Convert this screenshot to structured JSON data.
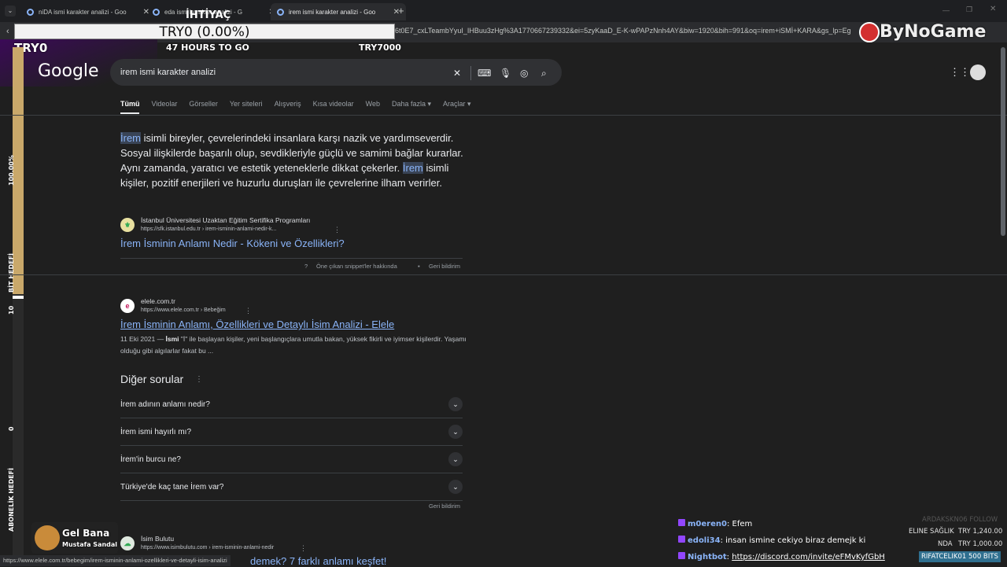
{
  "browser": {
    "tabs": [
      {
        "title": "niDA ismi karakter analizi - Goo"
      },
      {
        "title": "eda ismi karakter analizi - G"
      },
      {
        "title": "irem ismi karakter analizi - Goo"
      }
    ],
    "new_tab": "+",
    "url": "6t0E7_cxLTeambYyuI_IHBuu3zHg%3A1770667239332&ei=5zyKaaD_E-K-wPAPzNnh4AY&biw=1920&bih=991&oq=irem+iSMİ+KARA&gs_lp=Eg",
    "status_url": "https://www.elele.com.tr/bebegim/irem-isminin-anlami-ozellikleri-ve-detayli-isim-analizi"
  },
  "overlay": {
    "donation_label": "İHTİYAÇ",
    "donation_bar": "TRY0 (0.00%)",
    "left_value": "TRY0",
    "hours": "47 HOURS TO GO",
    "goal": "TRY7000",
    "brand": "ByNoGame",
    "bar_labels": {
      "pct": "100.00%",
      "bit": "BİT HEDEFİ",
      "ten": "10",
      "zero": "0",
      "abone": "ABONELİK HEDEFİ"
    },
    "streamer_song": "Gel Bana",
    "streamer_artist": "Mustafa Sandal"
  },
  "google": {
    "logo": "Google",
    "query": "irem ismi karakter analizi",
    "nav": [
      "Tümü",
      "Videolar",
      "Görseller",
      "Yer siteleri",
      "Alışveriş",
      "Kısa videolar",
      "Web",
      "Daha fazla ▾",
      "Araçlar ▾"
    ],
    "snippet": {
      "t1": "İrem",
      "t2": " isimli bireyler, çevrelerindeki insanlara karşı nazik ve yardımseverdir. Sosyal ilişkilerde başarılı olup, sevdikleriyle güçlü ve samimi bağlar kurarlar. Aynı zamanda, yaratıcı ve estetik yeteneklerle dikkat çekerler. ",
      "t3": "İrem",
      "t4": " isimli kişiler, pozitif enerjileri ve huzurlu duruşları ile çevrelerine ilham verirler."
    },
    "featured": {
      "site": "İstanbul Üniversitesi Uzaktan Eğitim Sertifika Programları",
      "url": "https://sfk.istanbul.edu.tr › irem-isminin-anlami-nedir-k...",
      "title": "İrem İsminin Anlamı Nedir - Kökeni ve Özellikleri?",
      "about": "Öne çıkan snippet'ler hakkında",
      "feedback": "Geri bildirim"
    },
    "result1": {
      "site": "elele.com.tr",
      "url": "https://www.elele.com.tr › Bebeğim",
      "title": "İrem İsminin Anlamı, Özellikleri ve Detaylı İsim Analizi - Elele",
      "date": "11 Eki 2021 —",
      "bold": "İsmi",
      "desc": " \"İ\" ile başlayan kişiler, yeni başlangıçlara umutla bakan, yüksek fikirli ve iyimser kişilerdir. Yaşamı olduğu gibi algılarlar fakat bu ..."
    },
    "other_questions": {
      "title": "Diğer sorular",
      "items": [
        "İrem adının anlamı nedir?",
        "İrem ismi hayırlı mı?",
        "İrem'in burcu ne?",
        "Türkiye'de kaç tane İrem var?"
      ],
      "feedback": "Geri bildirim"
    },
    "result2": {
      "site": "İsim Bulutu",
      "url": "https://www.isimbulutu.com › irem-isminin-anlami-nedir",
      "title": "demek? 7 farklı anlamı keşfet!"
    }
  },
  "chat": [
    {
      "user": "m0eren0",
      "msg": "Efem",
      "color": "#8ab4f8"
    },
    {
      "user": "edoli34",
      "msg": "insan ismine cekiyo biraz demejk ki",
      "color": "#8ab4f8"
    },
    {
      "user": "Nightbot",
      "msg": "https://discord.com/invite/eFMvKyfGbH",
      "color": "#8ab4f8"
    }
  ],
  "side_feed": {
    "follow": "ARDAKSKN06  FOLLOW",
    "line1_name": "ELINE SAĞLIK",
    "line1_amt": "TRY 1,240.00",
    "line2_name": "NDA",
    "line2_amt": "TRY 1,000.00",
    "bits": "RIFATCELIK01  500 BITS"
  }
}
